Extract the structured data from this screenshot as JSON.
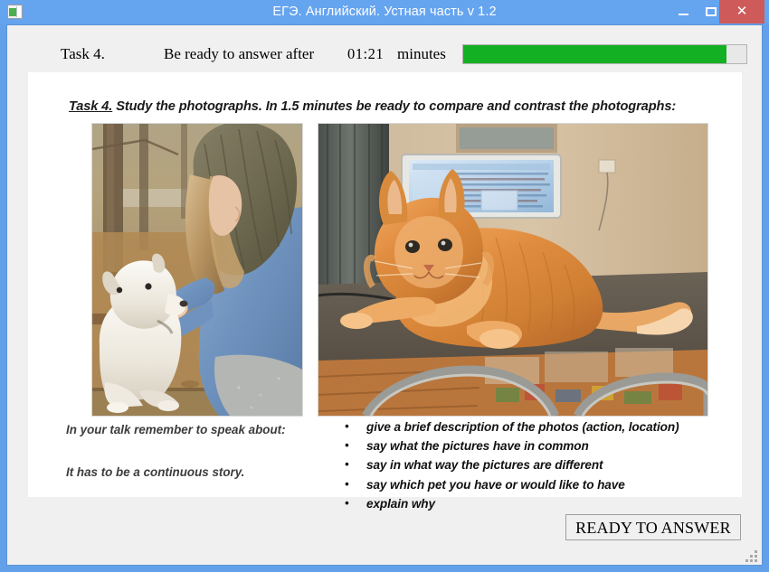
{
  "window": {
    "title": "ЕГЭ. Английский. Устная часть v 1.2",
    "icon": "app-icon",
    "controls": {
      "minimize": "minimize-icon",
      "maximize": "maximize-icon",
      "close_glyph": "✕"
    }
  },
  "toolbar": {
    "task_label": "Task 4.",
    "ready_prompt": "Be ready to answer after",
    "timer": "01:21",
    "minutes_label": "minutes",
    "progress_percent": 93,
    "progress_color": "#14b024",
    "progress_track_color": "#e8e8e8"
  },
  "content": {
    "instruction_tag": "Task 4.",
    "instruction_text": " Study the photographs. In 1.5 minutes be ready to compare and contrast the photographs:",
    "photo_left": {
      "alt": "Girl in blue jacket and olive knit hood petting a white puppy in an autumn park"
    },
    "photo_right": {
      "alt": "Fluffy ginger cat lying on a dark table in front of an open laptop"
    },
    "talk_about_label": "In your talk remember to speak about:",
    "continuous_story_label": "It has to be a continuous story.",
    "bullets": [
      "give a brief description of the photos (action, location)",
      "say what the pictures have in common",
      "say in what way the pictures are different",
      "say which pet you have or would like to have",
      "explain why"
    ]
  },
  "footer": {
    "ready_button": "READY TO ANSWER"
  },
  "colors": {
    "title_bar": "#65a4ef",
    "close_button": "#cf5a5a",
    "client_background": "#f0f0f0",
    "content_background": "#ffffff"
  }
}
